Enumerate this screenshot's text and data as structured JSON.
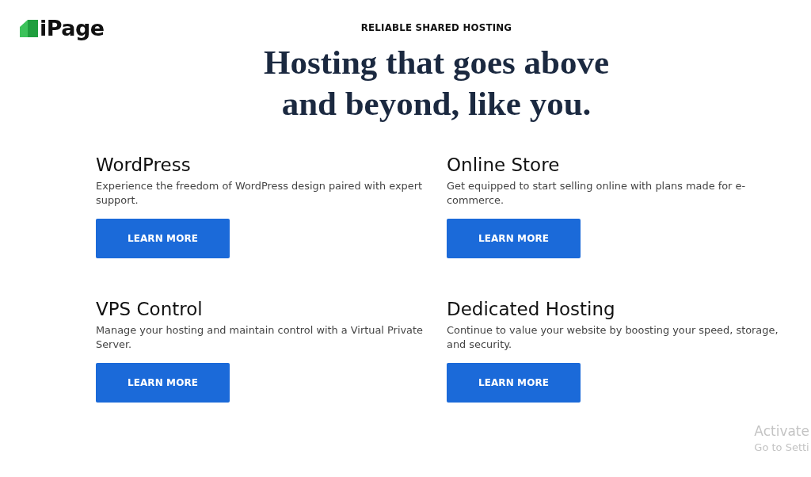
{
  "header": {
    "logo": {
      "text": "iPage"
    }
  },
  "hero": {
    "eyebrow": "RELIABLE SHARED HOSTING",
    "headline_lines": [
      "Hosting that goes above",
      "and beyond, like you."
    ]
  },
  "offerings": [
    {
      "title": "WordPress",
      "description": "Experience the freedom of WordPress design paired with expert support.",
      "button": "LEARN MORE"
    },
    {
      "title": "Online Store",
      "description": "Get equipped to start selling online with plans made for e-commerce.",
      "button": "LEARN MORE"
    },
    {
      "title": "VPS Control",
      "description": "Manage your hosting and maintain control with a Virtual Private Server.",
      "button": "LEARN MORE"
    },
    {
      "title": "Dedicated Hosting",
      "description": "Continue to value your website by boosting your speed, storage, and security.",
      "button": "LEARN MORE"
    }
  ],
  "os_notice": {
    "title": "Activate",
    "subtitle": "Go to Setti"
  }
}
